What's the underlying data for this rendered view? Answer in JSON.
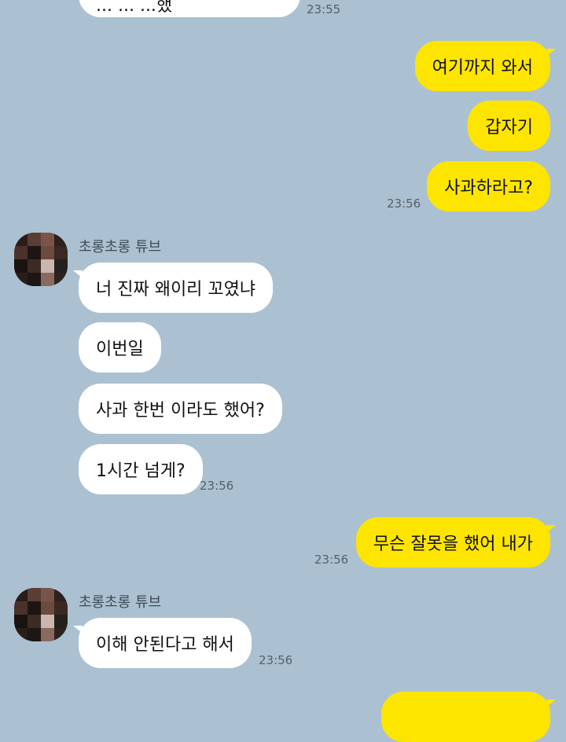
{
  "colors": {
    "background": "#abc1d1",
    "incoming_bubble": "#ffffff",
    "outgoing_bubble": "#fde500"
  },
  "messages": [
    {
      "direction": "in",
      "text": "... ... ...했"
    },
    {
      "timestamp": "23:55"
    },
    {
      "direction": "out",
      "text": "여기까지 와서"
    },
    {
      "direction": "out",
      "text": "갑자기"
    },
    {
      "direction": "out",
      "text": "사과하라고?"
    },
    {
      "timestamp": "23:56"
    },
    {
      "sender": "초롱초롱 튜브"
    },
    {
      "direction": "in",
      "text": "너 진짜 왜이리 꼬였냐"
    },
    {
      "direction": "in",
      "text": "이번일"
    },
    {
      "direction": "in",
      "text": "사과 한번 이라도 했어?"
    },
    {
      "direction": "in",
      "text": "1시간 넘게?"
    },
    {
      "timestamp": "23:56"
    },
    {
      "direction": "out",
      "text": "무슨 잘못을 했어 내가"
    },
    {
      "timestamp": "23:56"
    },
    {
      "sender": "초롱초롱 튜브"
    },
    {
      "direction": "in",
      "text": "이해 안된다고 해서"
    },
    {
      "timestamp": "23:56"
    },
    {
      "direction": "out",
      "text": ""
    }
  ]
}
